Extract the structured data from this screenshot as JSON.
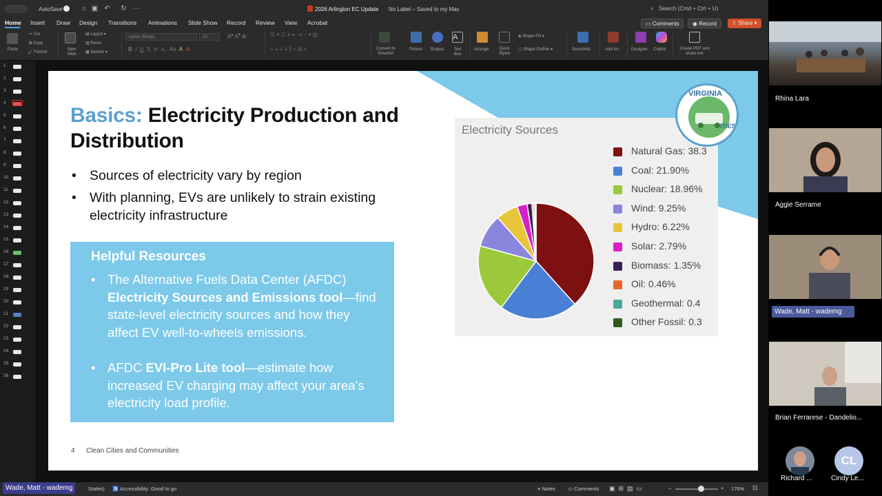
{
  "window": {
    "autosave_label": "AutoSave",
    "document_title": "2026 Arlington EC Update",
    "label_status": "No Label – Saved to my Mac",
    "search_placeholder": "Search (Cmd + Ctrl + U)"
  },
  "ribbon": {
    "tabs": [
      "Home",
      "Insert",
      "Draw",
      "Design",
      "Transitions",
      "Animations",
      "Slide Show",
      "Record",
      "Review",
      "View",
      "Acrobat"
    ],
    "active_tab": "Home",
    "comments_label": "Comments",
    "record_label": "Record",
    "share_label": "Share",
    "paste_label": "Paste",
    "cut_label": "Cut",
    "copy_label": "Copy",
    "format_label": "Format",
    "new_slide_label": "New Slide",
    "layout_label": "Layout",
    "reset_label": "Reset",
    "section_label": "Section",
    "font_name": "Aptos (Body)",
    "font_size": "12",
    "convert_label": "Convert to SmartArt",
    "picture_label": "Picture",
    "shapes_label": "Shapes",
    "textbox_label": "Text Box",
    "arrange_label": "Arrange",
    "quick_styles_label": "Quick Styles",
    "shape_fill_label": "Shape Fill",
    "shape_outline_label": "Shape Outline",
    "sensitivity_label": "Sensitivity",
    "addins_label": "Add-ins",
    "designer_label": "Designer",
    "copilot_label": "Copilot",
    "create_pdf_label": "Create PDF and share link"
  },
  "thumbnails": [
    "1",
    "2",
    "3",
    "4",
    "5",
    "6",
    "7",
    "8",
    "9",
    "10",
    "11",
    "12",
    "13",
    "14",
    "15",
    "16",
    "17",
    "18",
    "19",
    "20",
    "21",
    "22",
    "23",
    "24",
    "25",
    "26"
  ],
  "slide": {
    "title_accent": "Basics:",
    "title_rest": "Electricity Production and Distribution",
    "bullets": [
      "Sources of electricity vary by region",
      "With planning, EVs are unlikely to strain existing electricity infrastructure"
    ],
    "resources_title": "Helpful Resources",
    "resource1_a": "The Alternative Fuels Data Center (AFDC) ",
    "resource1_b": "Electricity Sources and Emissions tool",
    "resource1_c": "—find state-level electricity sources and how they affect EV well-to-wheels emissions.",
    "resource2_a": "AFDC ",
    "resource2_b": "EVI-Pro Lite tool",
    "resource2_c": "—estimate how increased EV charging may affect your area’s electricity load profile.",
    "page_number": "4",
    "footer": "Clean Cities and Communities",
    "logo_text_top": "VIRGINIA",
    "logo_text_right": "ITIES"
  },
  "chart_data": {
    "type": "pie",
    "title": "Electricity Sources",
    "categories": [
      "Natural Gas",
      "Coal",
      "Nuclear",
      "Wind",
      "Hydro",
      "Solar",
      "Biomass",
      "Oil",
      "Geothermal",
      "Other Fossil"
    ],
    "values": [
      38.3,
      21.9,
      18.96,
      9.25,
      6.22,
      2.79,
      1.35,
      0.46,
      0.4,
      0.3
    ],
    "legend_labels": [
      "38.3",
      "21.90%",
      "18.96%",
      "9.25%",
      "6.22%",
      "2.79%",
      "1.35%",
      "0.46%",
      "0.4",
      "0.3"
    ],
    "colors": [
      "#7d1010",
      "#4a7fd6",
      "#9cc93c",
      "#8a85dd",
      "#e8c53a",
      "#d81fc8",
      "#3a1f55",
      "#e8672a",
      "#4aa99a",
      "#2f5a1f"
    ],
    "legend_placement": "right"
  },
  "statusbar": {
    "language": "States)",
    "accessibility": "Accessibility: Good to go",
    "notes": "Notes",
    "comments": "Comments",
    "zoom": "176%"
  },
  "meeting": {
    "presenter_tag": "Wade, Matt - wademg",
    "participants": [
      "Rhina Lara",
      "Aggie Serrame",
      "Wade, Matt - wademg",
      "Brian Ferrarese - Dandelio..."
    ],
    "bottom_participants": [
      "Richard ...",
      "Cindy Le..."
    ],
    "initials": "CL"
  }
}
